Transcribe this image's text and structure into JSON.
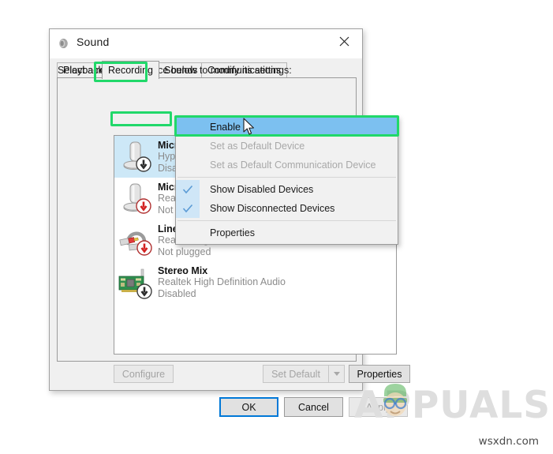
{
  "window": {
    "title": "Sound",
    "icon": "speaker-icon",
    "close_label": "✕"
  },
  "tabs": [
    {
      "id": "playback",
      "label": "Playback",
      "active": false
    },
    {
      "id": "recording",
      "label": "Recording",
      "active": true
    },
    {
      "id": "sounds",
      "label": "Sounds",
      "active": false
    },
    {
      "id": "communications",
      "label": "Communications",
      "active": false
    }
  ],
  "panel": {
    "instruction": "Select a recording device below to modify its settings:"
  },
  "devices": [
    {
      "name": "Microphone",
      "driver": "HyperX Cloud",
      "status": "Disabled",
      "icon": "microphone-icon",
      "badge": "disabled-arrow-badge",
      "selected": true
    },
    {
      "name": "Microphone",
      "driver": "Realtek High",
      "status": "Not plugged",
      "icon": "microphone-icon",
      "badge": "unplugged-arrow-badge",
      "selected": false
    },
    {
      "name": "Line In",
      "driver": "Realtek High",
      "status": "Not plugged",
      "icon": "line-in-rca-icon",
      "badge": "unplugged-arrow-badge",
      "selected": false
    },
    {
      "name": "Stereo Mix",
      "driver": "Realtek High Definition Audio",
      "status": "Disabled",
      "icon": "sound-card-icon",
      "badge": "disabled-arrow-badge",
      "selected": false
    }
  ],
  "context_menu": {
    "items": [
      {
        "label": "Enable",
        "state": "highlighted",
        "checked": false
      },
      {
        "label": "Set as Default Device",
        "state": "disabled",
        "checked": false
      },
      {
        "label": "Set as Default Communication Device",
        "state": "disabled",
        "checked": false
      },
      {
        "label": "Show Disabled Devices",
        "state": "normal",
        "checked": true
      },
      {
        "label": "Show Disconnected Devices",
        "state": "normal",
        "checked": true
      },
      {
        "label": "Properties",
        "state": "normal",
        "checked": false
      }
    ]
  },
  "buttons": {
    "configure": "Configure",
    "set_default": "Set Default",
    "set_default_arrow": "chevron-down-icon",
    "properties": "Properties",
    "ok": "OK",
    "cancel": "Cancel",
    "apply": "Apply"
  },
  "annotations": {
    "color": "#21d86a",
    "targets": [
      "Recording",
      "Microphone",
      "Enable"
    ]
  },
  "watermark": {
    "brand": "APPUALS",
    "site": "wsxdn.com"
  }
}
